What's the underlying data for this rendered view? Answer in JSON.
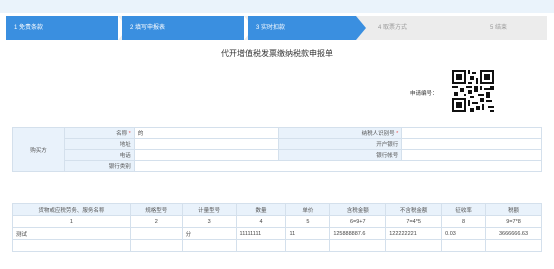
{
  "steps": [
    {
      "label": "1 免责条款"
    },
    {
      "label": "2 填写申报表"
    },
    {
      "label": "3 实时扣款"
    },
    {
      "label": "4 取票方式"
    },
    {
      "label": "5 结束"
    }
  ],
  "form": {
    "title": "代开增值税发票缴纳税款申报单",
    "application_no_label": "申请编号："
  },
  "buyer": {
    "section_label": "购买方",
    "name_label": "名称",
    "required_mark": "*",
    "name_value": "的",
    "taxpayer_id_label": "纳税人识别号",
    "taxpayer_id_value": "",
    "address_label": "地址",
    "address_value": "",
    "bank_label": "开户银行",
    "bank_value": "",
    "phone_label": "电话",
    "phone_value": "",
    "account_label": "银行帐号",
    "account_value": "",
    "bank_type_label": "银行类别",
    "bank_type_value": ""
  },
  "items": {
    "headers": [
      "货物或应税劳务、服务名称",
      "规格型号",
      "计量型号",
      "数量",
      "单价",
      "含税金额",
      "不含税金额",
      "征收率",
      "税额"
    ],
    "index_row": [
      "1",
      "2",
      "3",
      "4",
      "5",
      "6=9+7",
      "7=4*5",
      "8",
      "9=7*8"
    ],
    "rows": [
      [
        "测试",
        "",
        "分",
        "11111111",
        "11",
        "125888887.6",
        "122222221",
        "0.03",
        "3666666.63"
      ],
      [
        "",
        "",
        "",
        "",
        "",
        "",
        "",
        "",
        ""
      ]
    ]
  },
  "colors": {
    "active_step": "#3a8fe0",
    "header_bg": "#e9f2fb",
    "border": "#d4e0ec"
  }
}
